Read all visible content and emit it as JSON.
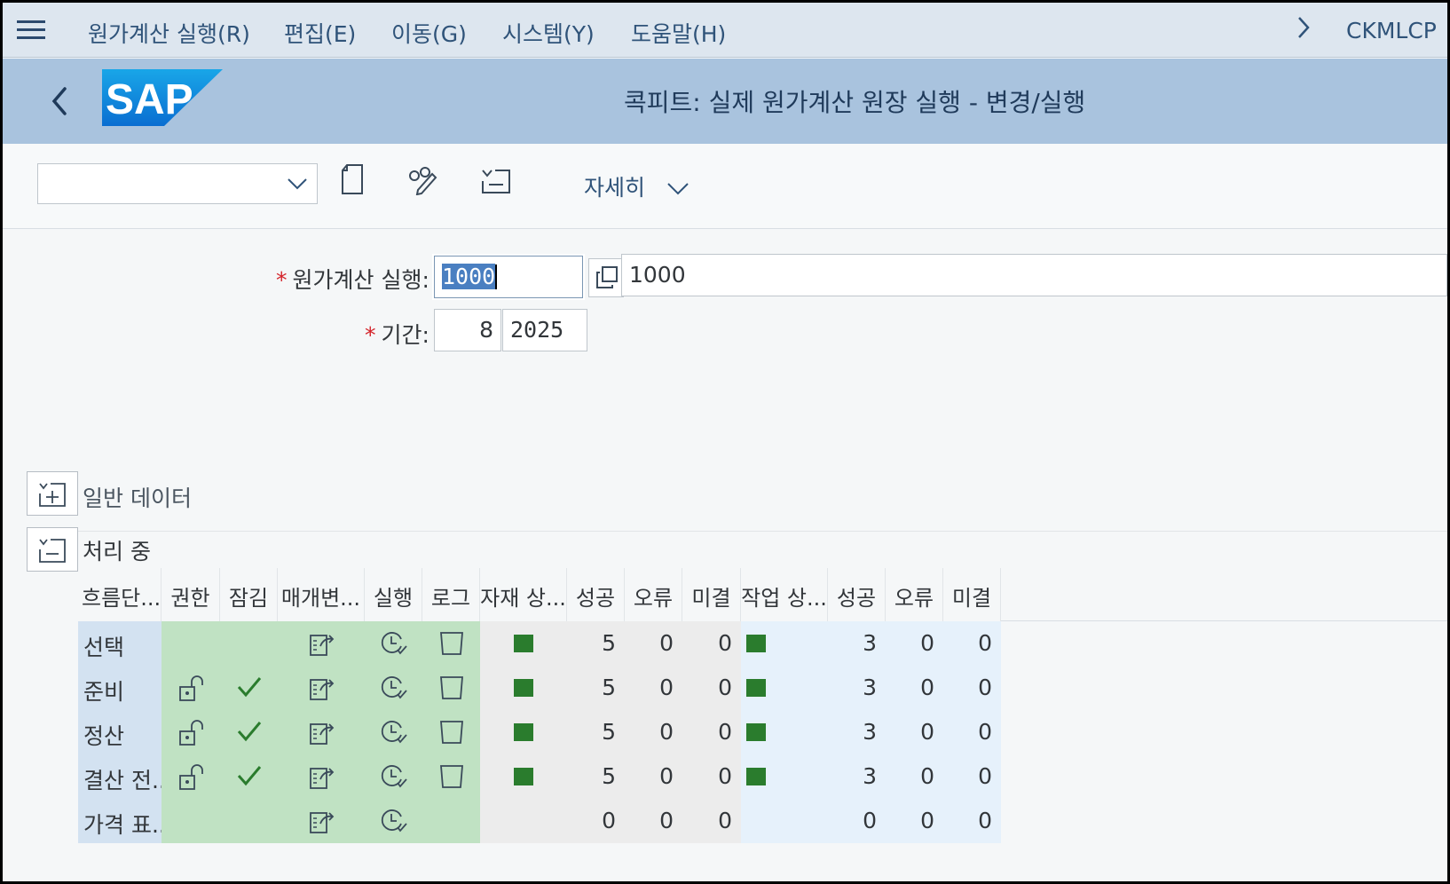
{
  "menubar": {
    "items": [
      "원가계산 실행(R)",
      "편집(E)",
      "이동(G)",
      "시스템(Y)",
      "도움말(H)"
    ],
    "tcode": "CKMLCP"
  },
  "header": {
    "logo_text": "SAP",
    "title": "콕피트: 실제 원가계산 원장 실행 - 변경/실행"
  },
  "toolbar": {
    "dropdown_value": "",
    "more_label": "자세히"
  },
  "form": {
    "costing_run_label": "원가계산 실행:",
    "costing_run_value": "1000",
    "costing_run_desc": "1000",
    "period_label": "기간:",
    "period_value": "8",
    "year_value": "2025",
    "required_mark": "*"
  },
  "sections": {
    "general": "일반 데이터",
    "processing": "처리 중"
  },
  "table": {
    "headers": [
      "흐름단...",
      "권한",
      "잠김",
      "매개변...",
      "실행",
      "로그",
      "자재 상...",
      "성공",
      "오류",
      "미결",
      "작업 상...",
      "성공",
      "오류",
      "미결"
    ],
    "rows": [
      {
        "step": "선택",
        "lock": false,
        "check": false,
        "log": true,
        "mat_status": true,
        "m_ok": "5",
        "m_err": "0",
        "m_open": "0",
        "job_status": true,
        "j_ok": "3",
        "j_err": "0",
        "j_open": "0"
      },
      {
        "step": "준비",
        "lock": true,
        "check": true,
        "log": true,
        "mat_status": true,
        "m_ok": "5",
        "m_err": "0",
        "m_open": "0",
        "job_status": true,
        "j_ok": "3",
        "j_err": "0",
        "j_open": "0"
      },
      {
        "step": "정산",
        "lock": true,
        "check": true,
        "log": true,
        "mat_status": true,
        "m_ok": "5",
        "m_err": "0",
        "m_open": "0",
        "job_status": true,
        "j_ok": "3",
        "j_err": "0",
        "j_open": "0"
      },
      {
        "step": "결산 전...",
        "lock": true,
        "check": true,
        "log": true,
        "mat_status": true,
        "m_ok": "5",
        "m_err": "0",
        "m_open": "0",
        "job_status": true,
        "j_ok": "3",
        "j_err": "0",
        "j_open": "0"
      },
      {
        "step": "가격 표...",
        "lock": false,
        "check": false,
        "log": false,
        "mat_status": false,
        "m_ok": "0",
        "m_err": "0",
        "m_open": "0",
        "job_status": false,
        "j_ok": "0",
        "j_err": "0",
        "j_open": "0"
      }
    ]
  },
  "colors": {
    "status_green": "#2a7c2d",
    "header_blue": "#a9c3de",
    "process_green": "#c0e2c3"
  }
}
